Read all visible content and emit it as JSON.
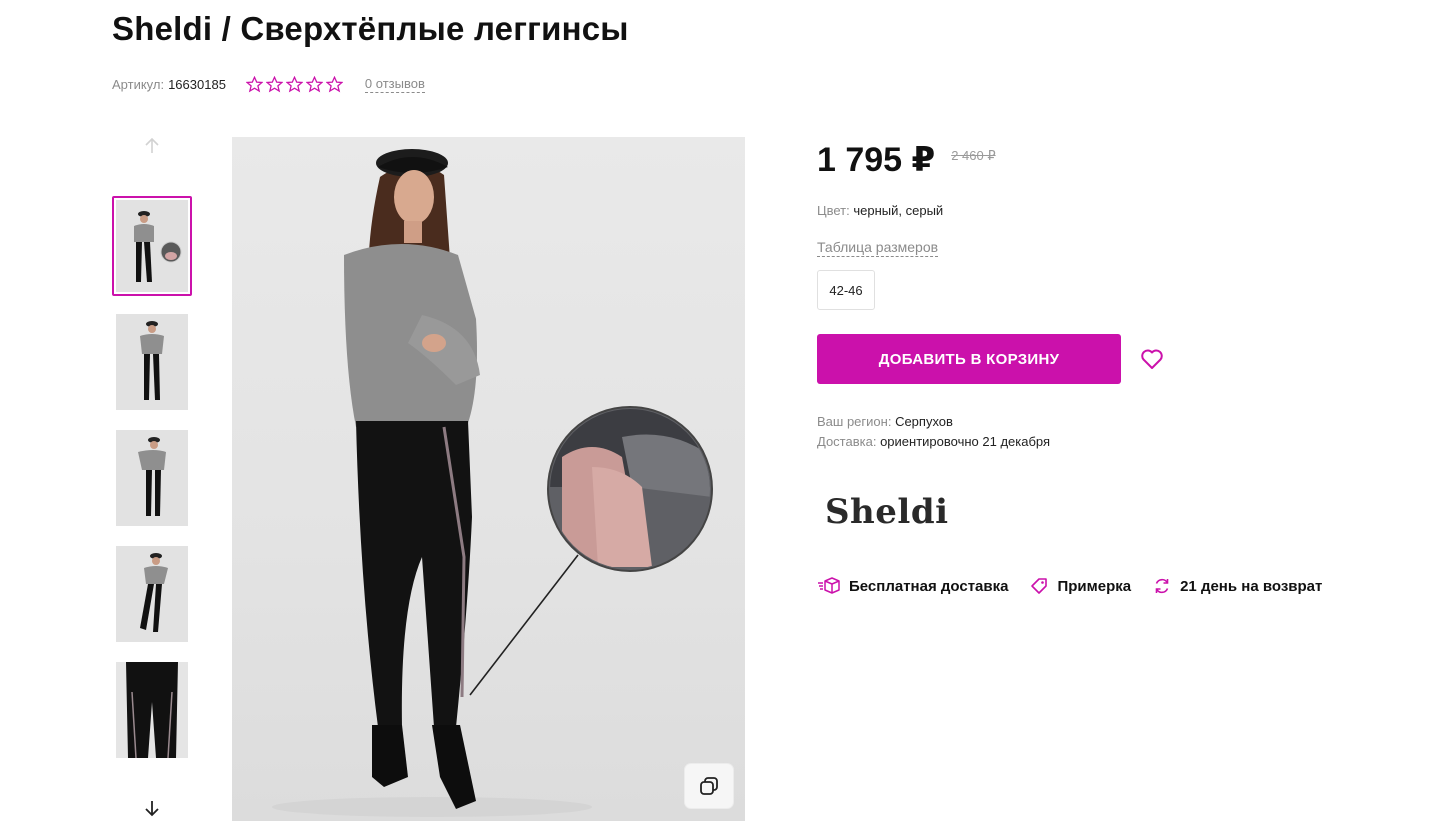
{
  "product": {
    "title": "Sheldi / Сверхтёплые леггинсы",
    "sku_label": "Артикул:",
    "sku_value": "16630185",
    "rating_stars": 5,
    "reviews_text": "0 отзывов"
  },
  "price": {
    "current": "1 795 ₽",
    "old": "2 460 ₽"
  },
  "color": {
    "label": "Цвет:",
    "value": "черный, серый"
  },
  "size": {
    "table_link": "Таблица размеров",
    "options": [
      "42-46"
    ]
  },
  "actions": {
    "add_to_cart": "ДОБАВИТЬ В КОРЗИНУ",
    "favorite_icon": "heart-icon"
  },
  "delivery": {
    "region_label": "Ваш регион:",
    "region_value": "Серпухов",
    "delivery_label": "Доставка:",
    "delivery_value": "ориентировочно 21 декабря"
  },
  "brand": {
    "name": "Sheldi"
  },
  "features": [
    {
      "icon": "box-delivery-icon",
      "label": "Бесплатная доставка"
    },
    {
      "icon": "tag-icon",
      "label": "Примерка"
    },
    {
      "icon": "refresh-icon",
      "label": "21 день на возврат"
    }
  ],
  "gallery": {
    "thumbnails": 5,
    "active_index": 0
  },
  "colors": {
    "accent": "#cb11ab",
    "text": "#111111",
    "muted": "#8b8b8b"
  }
}
